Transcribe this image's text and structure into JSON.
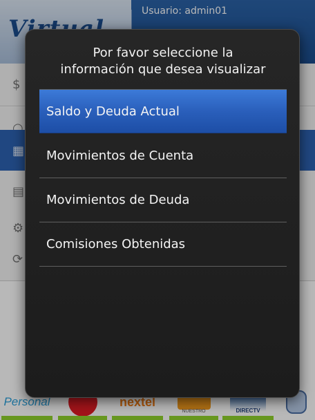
{
  "header": {
    "logo_text": "Virtual",
    "user_label": "Usuario: admin01"
  },
  "background_menu": {
    "icons": [
      "dollar-icon",
      "search-icon",
      "card-icon",
      "list-icon",
      "gear-icon",
      "refresh-icon"
    ],
    "selected_index": 2
  },
  "dialog": {
    "title_line1": "Por favor seleccione la",
    "title_line2": "información que desea visualizar",
    "options": [
      {
        "label": "Saldo y Deuda Actual",
        "selected": true
      },
      {
        "label": "Movimientos de Cuenta",
        "selected": false
      },
      {
        "label": "Movimientos de Deuda",
        "selected": false
      },
      {
        "label": "Comisiones Obtenidas",
        "selected": false
      }
    ]
  },
  "brands": {
    "personal": "Personal",
    "claro": "Claro",
    "nextel": "nextel",
    "nuestro": "NUESTRO",
    "directv": "DIRECTV"
  },
  "colors": {
    "header_blue": "#1b4d8e",
    "selected_option": "#2a5fbb",
    "dialog_bg": "#222222",
    "brand_stripe": "#8fd12b"
  }
}
